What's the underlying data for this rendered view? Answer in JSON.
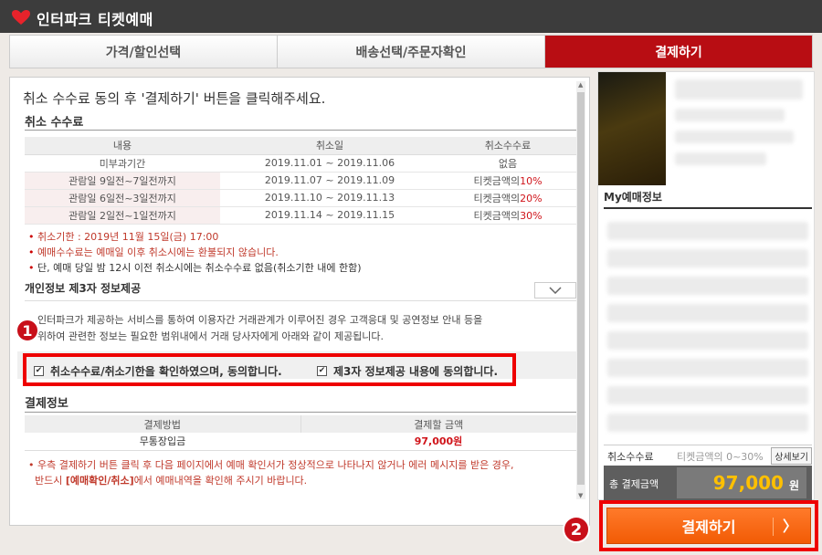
{
  "app": {
    "title": "인터파크 티켓예매"
  },
  "tabs": [
    "가격/할인선택",
    "배송선택/주문자확인",
    "결제하기"
  ],
  "intro": "취소 수수료 동의 후 '결제하기' 버튼을 클릭해주세요.",
  "cancel_fee": {
    "title": "취소 수수료",
    "headers": [
      "내용",
      "취소일",
      "취소수수료"
    ],
    "rows": [
      {
        "content": "미부과기간",
        "date": "2019.11.01 ~ 2019.11.06",
        "fee": "없음"
      },
      {
        "content": "관람일 9일전~7일전까지",
        "date": "2019.11.07 ~ 2019.11.09",
        "fee_prefix": "티켓금액의",
        "fee_pct": "10%"
      },
      {
        "content": "관람일 6일전~3일전까지",
        "date": "2019.11.10 ~ 2019.11.13",
        "fee_prefix": "티켓금액의",
        "fee_pct": "20%"
      },
      {
        "content": "관람일 2일전~1일전까지",
        "date": "2019.11.14 ~ 2019.11.15",
        "fee_prefix": "티켓금액의",
        "fee_pct": "30%"
      }
    ],
    "notes": [
      "취소기한 : 2019년 11월 15일(금) 17:00",
      "예매수수료는 예매일 이후 취소시에는 환불되지 않습니다.",
      "단, 예매 당일 밤 12시 이전 취소시에는 취소수수료 없음(취소기한 내에 한함)"
    ]
  },
  "privacy": {
    "title": "개인정보 제3자 정보제공",
    "dropdown_icon": "chevron-down-icon",
    "line1": "인터파크가 제공하는 서비스를 통하여 이용자간 거래관계가 이루어진 경우 고객응대 및 공연정보 안내 등을",
    "line2": "위하여 관련한 정보는 필요한 범위내에서 거래 당사자에게 아래와 같이 제공됩니다."
  },
  "agree": {
    "check1": "취소수수료/취소기한을 확인하였으며, 동의합니다.",
    "check2": "제3자 정보제공 내용에 동의합니다."
  },
  "badges": {
    "one": "1",
    "two": "2"
  },
  "payment": {
    "title": "결제정보",
    "headers": [
      "결제방법",
      "결제할 금액"
    ],
    "method": "무통장입금",
    "amount": "97,000원",
    "note1": "우측 결제하기 버튼 클릭 후 다음 페이지에서 예매 확인서가 정상적으로 나타나지 않거나 에러 메시지를 받은 경우,",
    "note2_pre": "반드시 ",
    "note2_bold": "[예매확인/취소]",
    "note2_post": "에서 예매내역을 확인해 주시기 바랍니다."
  },
  "right": {
    "my_info": "My예매정보",
    "fee_label": "취소수수료",
    "fee_value": "티켓금액의 0~30%",
    "detail_btn": "상세보기",
    "total_label": "총 결제금액",
    "total_amount": "97,000",
    "total_unit": "원",
    "pay_button": "결제하기",
    "pay_arrow": "〉"
  },
  "colors": {
    "brand_red": "#b80d13",
    "highlight_red": "#e00000",
    "pay_orange": "#f56a13",
    "amount_yellow": "#ffc000"
  }
}
